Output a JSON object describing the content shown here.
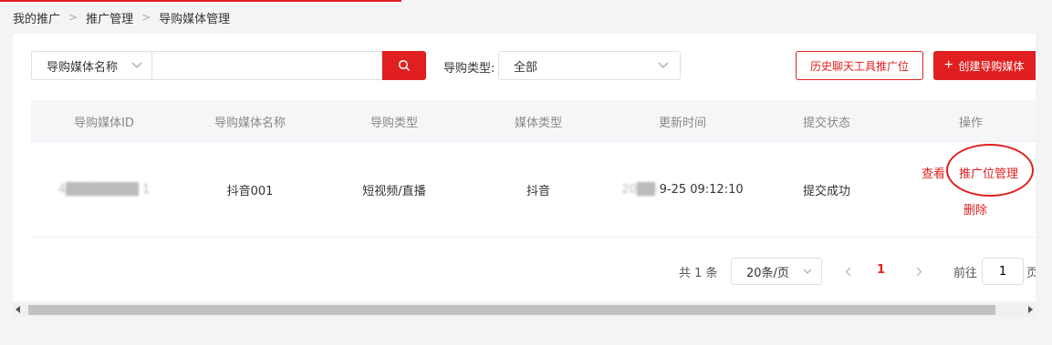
{
  "breadcrumb": {
    "items": [
      "我的推广",
      "推广管理",
      "导购媒体管理"
    ]
  },
  "search": {
    "field_select": "导购媒体名称",
    "value": "",
    "placeholder": ""
  },
  "filter": {
    "type_label": "导购类型:",
    "type_value": "全部"
  },
  "buttons": {
    "history": "历史聊天工具推广位",
    "create": "创建导购媒体",
    "create_icon": "+"
  },
  "table": {
    "headers": [
      "导购媒体ID",
      "导购媒体名称",
      "导购类型",
      "媒体类型",
      "更新时间",
      "提交状态",
      "操作"
    ],
    "rows": [
      {
        "id": "4████████ 1",
        "name": "抖音001",
        "guide_type": "短视频/直播",
        "media_type": "抖音",
        "updated_prefix": "20██-",
        "updated_suffix": "9-25 09:12:10",
        "status": "提交成功",
        "actions": {
          "view": "查看",
          "manage_slots": "推广位管理",
          "delete": "删除"
        }
      }
    ]
  },
  "pagination": {
    "total_text": "共 1 条",
    "page_size": "20条/页",
    "current_page": "1",
    "goto_label": "前往",
    "goto_value": "1",
    "page_suffix": "页"
  },
  "colors": {
    "accent": "#e02020",
    "header_bg": "#f5f6f7",
    "page_bg": "#f4f4f5"
  },
  "icons": {
    "search": "search-icon",
    "chevron": "chevron-down-icon",
    "prev": "chevron-left-icon",
    "next": "chevron-right-icon"
  }
}
